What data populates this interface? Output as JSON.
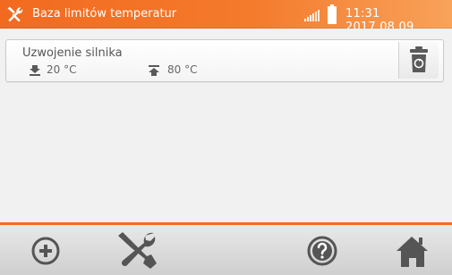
{
  "header": {
    "title": "Baza limitów temperatur",
    "time": "11:31 2017.08.09",
    "tools_icon": "tools-icon",
    "signal_icon": "signal-icon",
    "battery_icon": "battery-icon"
  },
  "list": {
    "items": [
      {
        "name": "Uzwojenie silnika",
        "min": "20 °C",
        "max": "80 °C",
        "min_icon": "arrow-down-icon",
        "max_icon": "arrow-up-icon",
        "delete_icon": "trash-icon"
      }
    ]
  },
  "toolbar": {
    "add_icon": "add-icon",
    "settings_icon": "tools-icon",
    "help_icon": "help-icon",
    "home_icon": "home-icon"
  },
  "colors": {
    "accent": "#f26a20",
    "icon_gray": "#5a5a5a"
  }
}
